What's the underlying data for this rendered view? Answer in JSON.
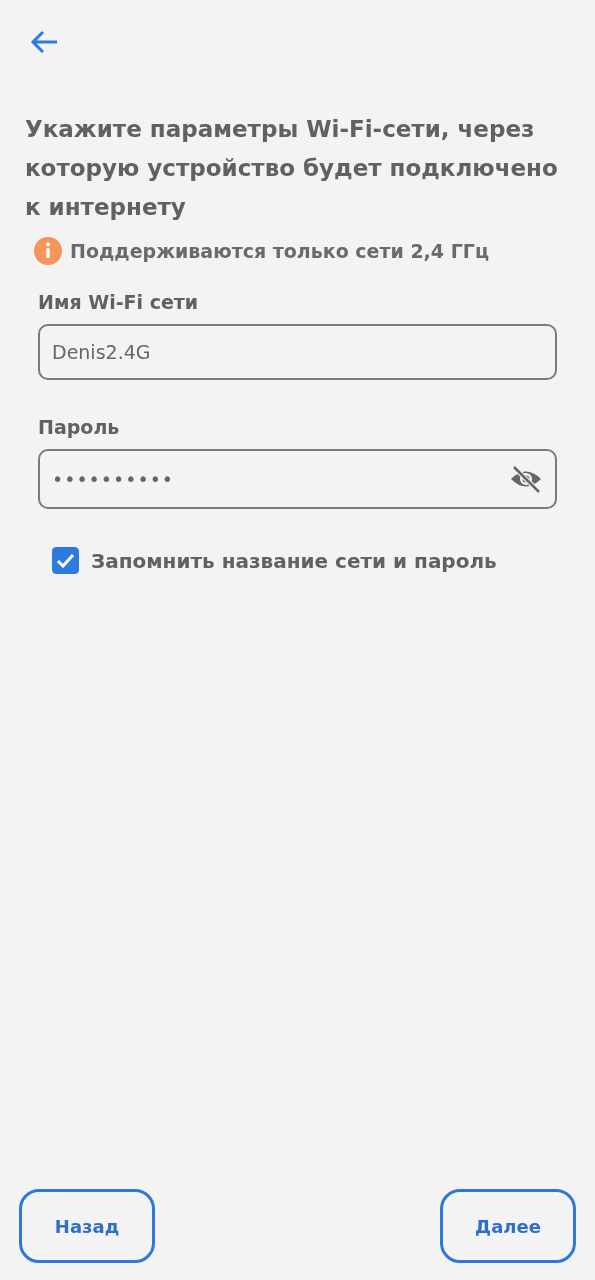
{
  "title": "Укажите параметры Wi-Fi-сети, через которую устройство будет подключено к интернету",
  "notice": "Поддерживаются только сети 2,4 ГГц",
  "fields": [
    {
      "kind": "text",
      "label": "Имя Wi-Fi сети",
      "value": "Denis2.4G"
    },
    {
      "kind": "password",
      "label": "Пароль",
      "value": "••••••••••",
      "password_visible": false
    }
  ],
  "remember": {
    "label": "Запомнить название сети и пароль",
    "checked": true
  },
  "buttons": [
    {
      "label": "Назад"
    },
    {
      "label": "Далее"
    }
  ]
}
